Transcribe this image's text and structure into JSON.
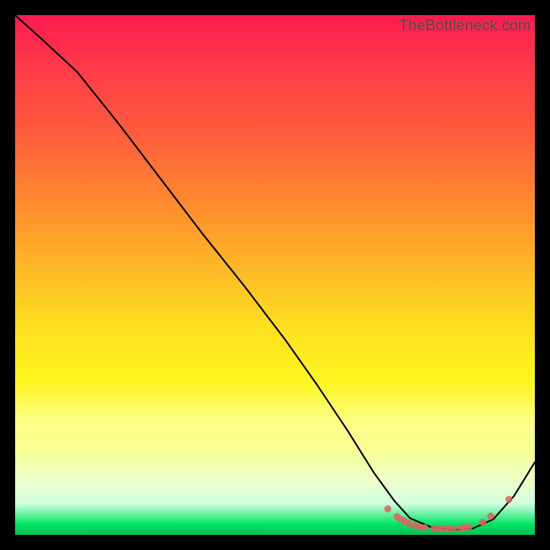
{
  "watermark": "TheBottleneck.com",
  "chart_data": {
    "type": "line",
    "title": "",
    "xlabel": "",
    "ylabel": "",
    "xlim": [
      0,
      1
    ],
    "ylim": [
      0,
      1
    ],
    "legend": false,
    "grid": false,
    "series": [
      {
        "name": "bottleneck-curve",
        "color": "#000000",
        "x": [
          0.0,
          0.05,
          0.12,
          0.2,
          0.28,
          0.36,
          0.44,
          0.52,
          0.58,
          0.64,
          0.69,
          0.73,
          0.76,
          0.8,
          0.84,
          0.88,
          0.92,
          0.96,
          1.0
        ],
        "y": [
          1.0,
          0.955,
          0.89,
          0.79,
          0.685,
          0.58,
          0.48,
          0.375,
          0.29,
          0.2,
          0.12,
          0.065,
          0.032,
          0.015,
          0.01,
          0.012,
          0.03,
          0.075,
          0.14
        ]
      }
    ],
    "markers": [
      {
        "name": "optimal-zone-dots",
        "color": "#e06060",
        "x": [
          0.717,
          0.735,
          0.742,
          0.749,
          0.758,
          0.769,
          0.777,
          0.788,
          0.806,
          0.815,
          0.826,
          0.834,
          0.844,
          0.858,
          0.865,
          0.873,
          0.9,
          0.915,
          0.95
        ],
        "y": [
          0.05,
          0.035,
          0.03,
          0.026,
          0.022,
          0.018,
          0.016,
          0.014,
          0.012,
          0.012,
          0.012,
          0.012,
          0.012,
          0.013,
          0.014,
          0.015,
          0.024,
          0.036,
          0.068
        ]
      }
    ],
    "background": {
      "type": "vertical-gradient",
      "stops": [
        {
          "pos": 0.0,
          "color": "#ff1a4d"
        },
        {
          "pos": 0.36,
          "color": "#ff8a2e"
        },
        {
          "pos": 0.6,
          "color": "#ffe020"
        },
        {
          "pos": 0.85,
          "color": "#f5ffa0"
        },
        {
          "pos": 0.98,
          "color": "#00e463"
        }
      ]
    }
  }
}
